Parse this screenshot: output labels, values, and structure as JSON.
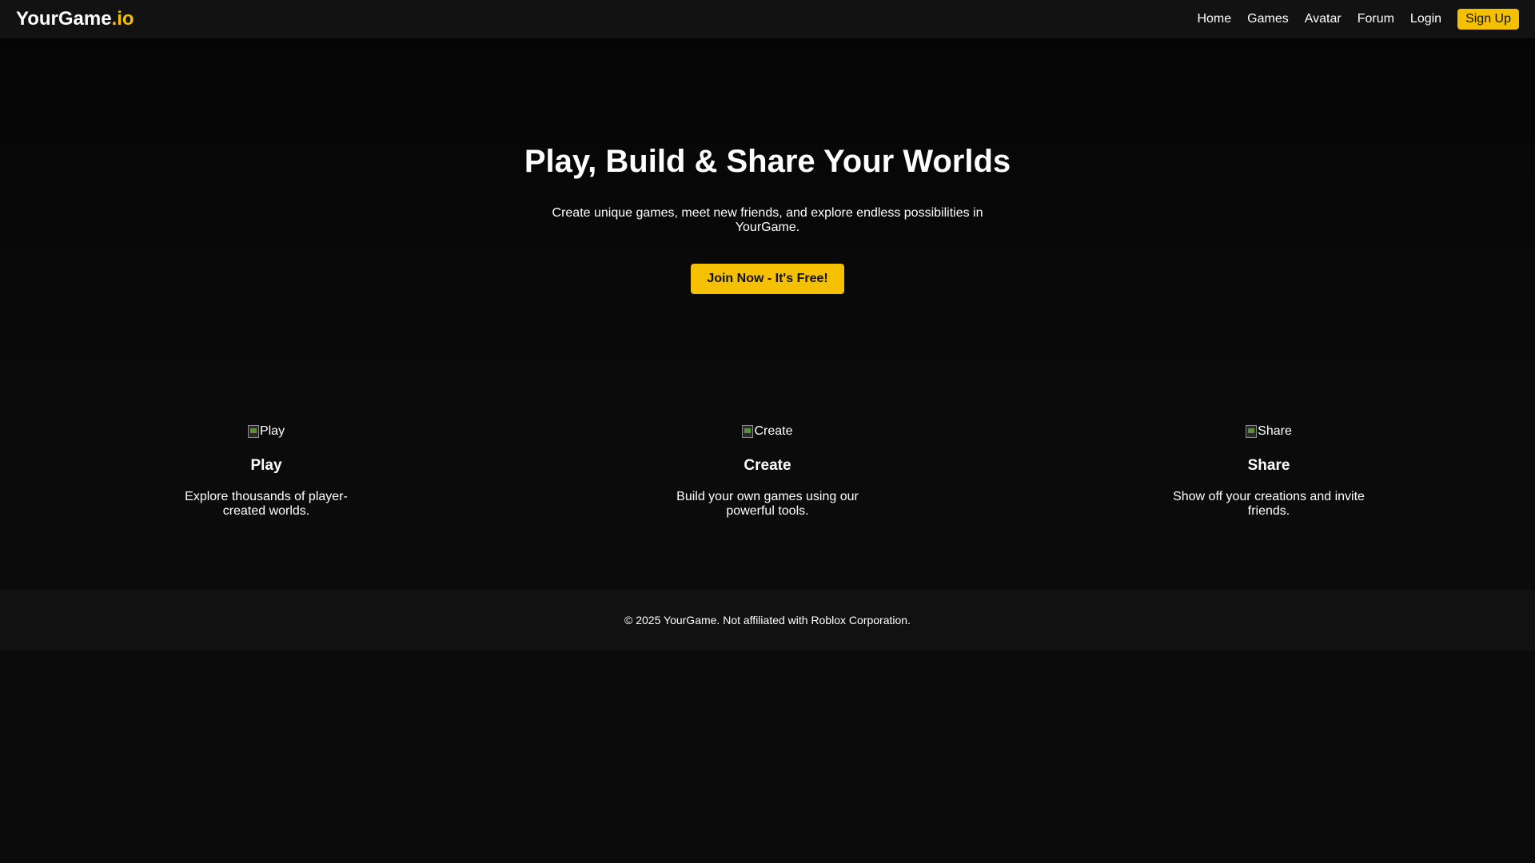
{
  "nav": {
    "logo_main": "YourGame",
    "logo_accent": ".io",
    "links": [
      "Home",
      "Games",
      "Avatar",
      "Forum",
      "Login"
    ],
    "signup_label": "Sign Up"
  },
  "hero": {
    "title": "Play, Build & Share Your Worlds",
    "subtitle": "Create unique games, meet new friends, and explore endless possibilities in YourGame.",
    "cta_label": "Join Now - It's Free!"
  },
  "features": [
    {
      "image_alt": "Play",
      "title": "Play",
      "description": "Explore thousands of player-created worlds."
    },
    {
      "image_alt": "Create",
      "title": "Create",
      "description": "Build your own games using our powerful tools."
    },
    {
      "image_alt": "Share",
      "title": "Share",
      "description": "Show off your creations and invite friends."
    }
  ],
  "footer": {
    "text": "© 2025 YourGame. Not affiliated with Roblox Corporation."
  },
  "colors": {
    "accent": "#f5c000",
    "background": "#0b0b0b",
    "nav_background": "#121212",
    "footer_background": "#111111"
  }
}
